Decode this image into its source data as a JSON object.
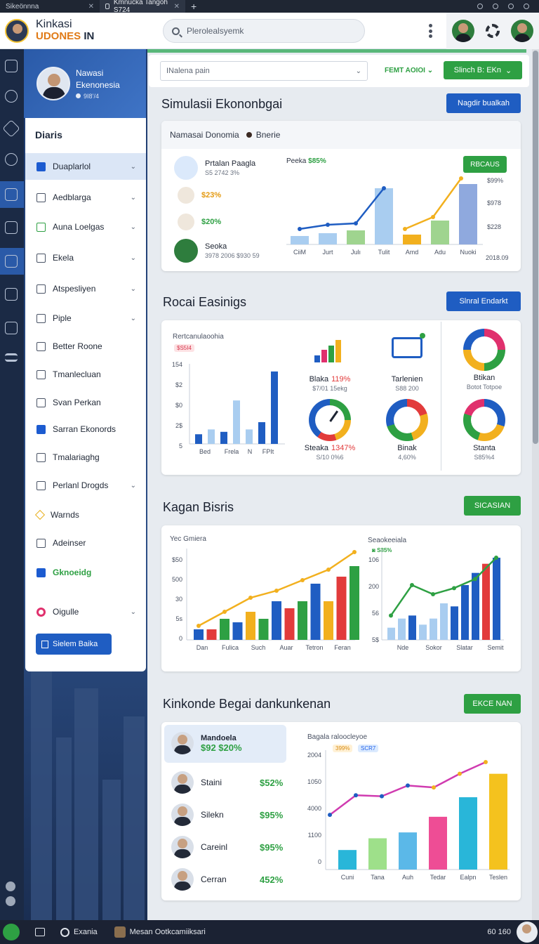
{
  "browser": {
    "tabs": [
      {
        "label": "Sikeönnna"
      },
      {
        "label": "Kmnucka Tangoh S724"
      }
    ]
  },
  "header": {
    "logo_line1": "Kinkasi",
    "logo_line2_orange": "UDONES",
    "logo_line2_dark": " IN",
    "search_placeholder": "Plerolealsyemk"
  },
  "profile": {
    "name_line1": "Nawasi",
    "name_line2": "Ekenonesia",
    "status": "9I8’/4"
  },
  "menu": {
    "title": "Diaris",
    "items": [
      {
        "label": "Duaplarlol",
        "icon": "chart-square-icon",
        "chevron": true,
        "selected": true
      },
      {
        "label": "Aedblarga",
        "icon": "square-icon",
        "chevron": true
      },
      {
        "label": "Auna Loelgas",
        "icon": "home-icon",
        "chevron": true
      },
      {
        "label": "Ekela",
        "icon": "square-icon",
        "chevron": true
      },
      {
        "label": "Atspesliyen",
        "icon": "gear-icon",
        "chevron": true
      },
      {
        "label": "Piple",
        "icon": "square-icon",
        "chevron": true
      },
      {
        "label": "Better Roone",
        "icon": "check-square-icon",
        "chevron": false
      },
      {
        "label": "Tmanlecluan",
        "icon": "square-icon",
        "chevron": false
      },
      {
        "label": "Svan Perkan",
        "icon": "check-square-icon",
        "chevron": false
      },
      {
        "label": "Sarran Ekonords",
        "icon": "checked-box-icon",
        "chevron": false
      },
      {
        "label": "Tmalariaghg",
        "icon": "book-icon",
        "chevron": false
      },
      {
        "label": "Perlanl Drogds",
        "icon": "tag-icon",
        "chevron": true
      },
      {
        "label": "Warnds",
        "icon": "star-icon",
        "chevron": false
      },
      {
        "label": "Adeinser",
        "icon": "square-icon",
        "chevron": false
      },
      {
        "label": "Gknoeidg",
        "icon": "checked-box-icon",
        "chevron": false
      },
      {
        "label": "Oigulle",
        "icon": "target-icon",
        "chevron": true
      }
    ],
    "button_label": "Sielem Baika"
  },
  "filter": {
    "select_value": "INalena pain",
    "link_label": "FEMT AOIOI",
    "button_label": "Slinch B: EKn"
  },
  "section1": {
    "title": "Simulasii Ekononbgai",
    "button_label": "Nagdir bualkah",
    "card_header": "Namasai Donomia",
    "card_header_tag": "Bnerie",
    "kpis": [
      {
        "title": "Prtalan Paagla",
        "sub": "S5 2742 3%"
      },
      {
        "value": "$23%"
      },
      {
        "value": "$20%"
      },
      {
        "title": "Seoka",
        "sub": "3978 2006  $930 59"
      }
    ],
    "peak_label": "Peeka",
    "peak_value": "$85%",
    "badge_label": "RBCAUS",
    "right_labels": [
      "$99%",
      "$978",
      "$228",
      "2018.09"
    ],
    "chart_data": {
      "type": "bar",
      "categories": [
        "CiiM",
        "Jurt",
        "Julı",
        "Tulit",
        "Amd",
        "Adu",
        "Nuoki"
      ],
      "values": [
        12,
        16,
        20,
        80,
        14,
        34,
        86
      ],
      "line": [
        22,
        28,
        30,
        80,
        28,
        45,
        100
      ]
    }
  },
  "section2": {
    "title": "Rocai Easinigs",
    "button_label": "Slnral Endarkt",
    "chart_title": "Rertcanulaoohia",
    "chart_chip": "$S5I4",
    "y_ticks": [
      "154",
      "$2",
      "$0",
      "2$",
      "5"
    ],
    "chart_data": {
      "type": "bar",
      "categories": [
        "Bed",
        "Frela",
        "N",
        "FPIt"
      ],
      "values": [
        2,
        3,
        2.5,
        9,
        3,
        4.5,
        15
      ]
    },
    "widgets": [
      {
        "name": "bar-chart-widget",
        "title": "Blaka",
        "pct": "119%",
        "sub": "$7/01 15ekg"
      },
      {
        "name": "building-widget",
        "title": "Tarlenien",
        "sub": "S88 200"
      },
      {
        "name": "donut-widget-1",
        "title": "Btikan",
        "sub": "Botot Totpoe"
      },
      {
        "name": "gauge-widget",
        "title": "Steaka",
        "pct": "1347%",
        "sub": "S/10 0%6"
      },
      {
        "name": "donut-widget-2",
        "title": "Binak",
        "sub": "4,60%"
      },
      {
        "name": "donut-widget-3",
        "title": "Stanta",
        "sub": "S85%4"
      }
    ]
  },
  "section3": {
    "title": "Kagan Bisris",
    "button_label": "SICASIAN",
    "left_chart": {
      "title": "Yec Gmiera",
      "y_ticks": [
        "$50",
        "500",
        "30",
        "5s",
        "0"
      ],
      "chart_data": {
        "type": "bar",
        "categories": [
          "Dan",
          "Fulica",
          "Such",
          "Auar",
          "Tetron",
          "Feran"
        ],
        "values": [
          3,
          3,
          6,
          5,
          8,
          6,
          11,
          9,
          11,
          16,
          11,
          18,
          21
        ],
        "line": [
          4,
          6,
          8,
          10,
          12,
          14,
          14,
          16,
          17,
          18,
          20,
          21,
          25
        ]
      }
    },
    "right_chart": {
      "title": "Seaokeeiala",
      "chip_value": "S85%",
      "y_ticks": [
        "106",
        "200",
        "56",
        "5$"
      ],
      "chart_data": {
        "type": "bar",
        "categories": [
          "Nde",
          "Sokor",
          "Slatar",
          "Semit"
        ],
        "values": [
          4,
          7,
          8,
          5,
          7,
          12,
          11,
          18,
          22,
          25,
          27
        ],
        "line": [
          8,
          11,
          18,
          17,
          15,
          20,
          17,
          16,
          20,
          25,
          27
        ]
      }
    }
  },
  "section4": {
    "title": "Kinkonde Begai dankunkenan",
    "button_label": "EKCE NAN",
    "people": [
      {
        "name": "Mandoela",
        "value": "$92 $20%",
        "highlight": true
      },
      {
        "name": "Staini",
        "value": "$52%"
      },
      {
        "name": "Silekn",
        "value": "$95%"
      },
      {
        "name": "Careinl",
        "value": "$95%"
      },
      {
        "name": "Cerran",
        "value": "452%"
      }
    ],
    "chart": {
      "title": "Bagala raloocleyoe",
      "chip1": "399%",
      "chip2": "SCR7",
      "y_ticks": [
        "2004",
        "1050",
        "4000",
        "1100",
        "0"
      ],
      "chart_data": {
        "type": "bar",
        "categories": [
          "Cuni",
          "Tana",
          "Auh",
          "Tedar",
          "Ealpn",
          "Teslen"
        ],
        "values": [
          200,
          320,
          380,
          540,
          740,
          980
        ],
        "line": [
          560,
          760,
          750,
          860,
          840,
          980,
          1100
        ]
      }
    }
  },
  "taskbar": {
    "item1": "Exania",
    "item2": "Mesan Ootkcamiiksari",
    "tray": "60 160"
  }
}
